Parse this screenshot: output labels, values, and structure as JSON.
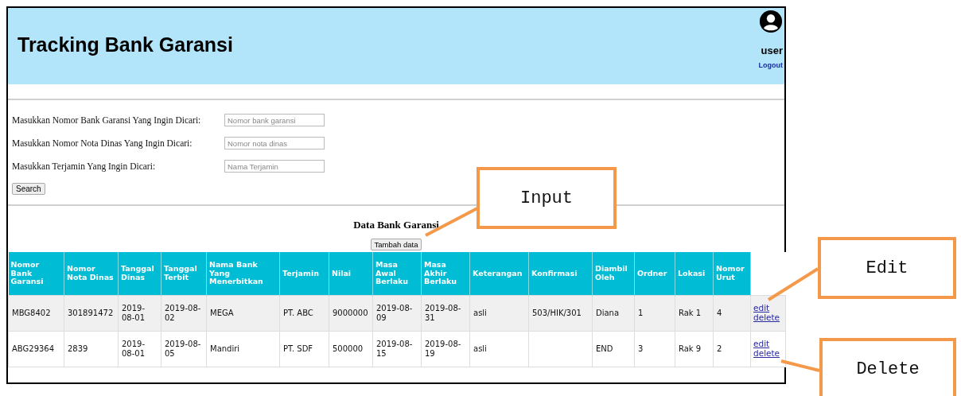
{
  "header": {
    "title": "Tracking Bank Garansi",
    "username": "user",
    "logout": "Logout"
  },
  "search_form": {
    "fields": [
      {
        "label": "Masukkan Nomor Bank Garansi Yang Ingin Dicari:",
        "placeholder": "Nomor bank garansi"
      },
      {
        "label": "Masukkan Nomor Nota Dinas Yang Ingin Dicari:",
        "placeholder": "Nomor nota dinas"
      },
      {
        "label": "Masukkan Terjamin Yang Ingin Dicari:",
        "placeholder": "Nama Terjamin"
      }
    ],
    "button": "Search"
  },
  "table_section": {
    "title": "Data Bank Garansi",
    "add_button": "Tambah data"
  },
  "table": {
    "columns": [
      "Nomor Bank Garansi",
      "Nomor Nota Dinas",
      "Tanggal Dinas",
      "Tanggal Terbit",
      "Nama Bank Yang Menerbitkan",
      "Terjamin",
      "Nilai",
      "Masa Awal Berlaku",
      "Masa Akhir Berlaku",
      "Keterangan",
      "Konfirmasi",
      "Diambil Oleh",
      "Ordner",
      "Lokasi",
      "Nomor Urut"
    ],
    "rows": [
      {
        "cells": [
          "MBG8402",
          "301891472",
          "2019-08-01",
          "2019-08-02",
          "MEGA",
          "PT. ABC",
          "9000000",
          "2019-08-09",
          "2019-08-31",
          "asli",
          "503/HIK/301",
          "Diana",
          "1",
          "Rak 1",
          "4"
        ],
        "edit": "edit",
        "delete": "delete"
      },
      {
        "cells": [
          "ABG29364",
          "2839",
          "2019-08-01",
          "2019-08-05",
          "Mandiri",
          "PT. SDF",
          "500000",
          "2019-08-15",
          "2019-08-19",
          "asli",
          "",
          "END",
          "3",
          "Rak 9",
          "2"
        ],
        "edit": "edit",
        "delete": "delete"
      }
    ]
  },
  "annotations": [
    {
      "kind": "input",
      "text": "Input"
    },
    {
      "kind": "edit",
      "text": "Edit"
    },
    {
      "kind": "delete",
      "text": "Delete"
    }
  ]
}
